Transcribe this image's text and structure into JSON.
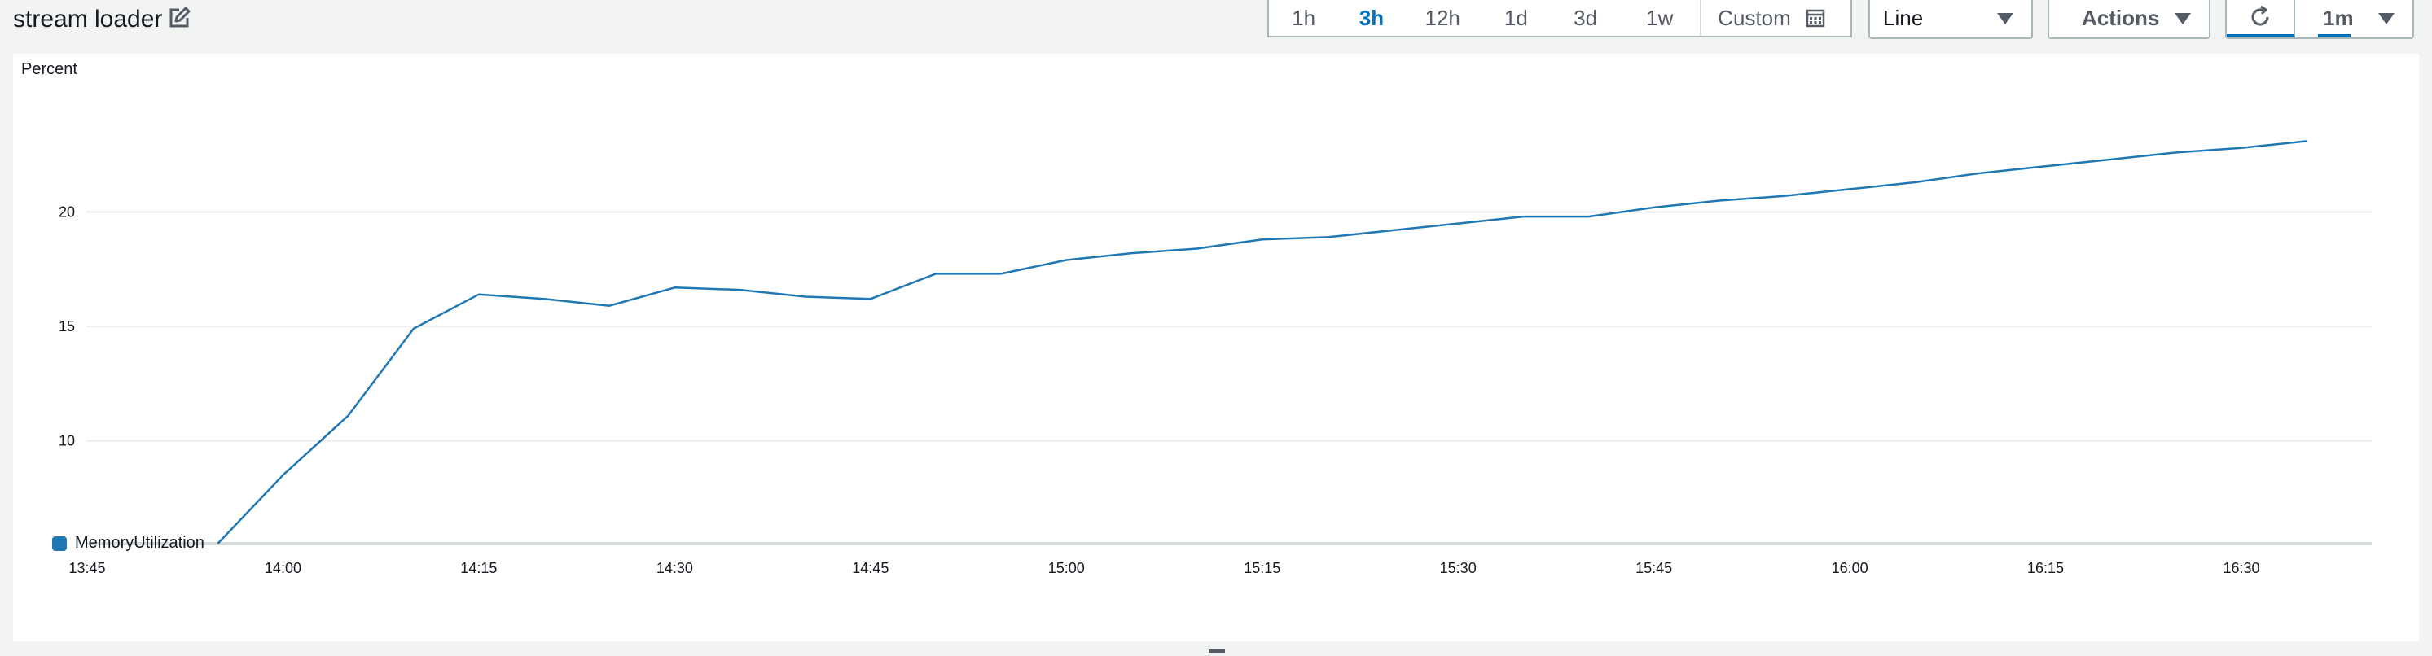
{
  "widget": {
    "title": "stream loader",
    "edit_icon": "edit-icon"
  },
  "time_range": {
    "options": [
      "1h",
      "3h",
      "12h",
      "1d",
      "3d",
      "1w"
    ],
    "active": "3h",
    "custom_label": "Custom",
    "calendar_icon": "calendar-icon"
  },
  "chart_type_dropdown": {
    "selected": "Line"
  },
  "actions_dropdown": {
    "label": "Actions"
  },
  "refresh": {
    "icon": "refresh-icon",
    "interval": "1m"
  },
  "colors": {
    "series": "#1f77b4",
    "active_tab": "#0073bb"
  },
  "chart_data": {
    "type": "line",
    "ylabel": "Percent",
    "xlabel": "",
    "ylim": [
      5.5,
      25
    ],
    "y_ticks": [
      10,
      15,
      20
    ],
    "x_tick_labels": [
      "13:45",
      "14:00",
      "14:15",
      "14:30",
      "14:45",
      "15:00",
      "15:15",
      "15:30",
      "15:45",
      "16:00",
      "16:15",
      "16:30"
    ],
    "x_start": "13:45",
    "x_end": "16:40",
    "grid": true,
    "legend_position": "bottom-left",
    "series": [
      {
        "name": "MemoryUtilization",
        "x": [
          "13:55",
          "14:00",
          "14:05",
          "14:10",
          "14:15",
          "14:20",
          "14:25",
          "14:30",
          "14:35",
          "14:40",
          "14:45",
          "14:50",
          "14:55",
          "15:00",
          "15:05",
          "15:10",
          "15:15",
          "15:20",
          "15:25",
          "15:30",
          "15:35",
          "15:40",
          "15:45",
          "15:50",
          "15:55",
          "16:00",
          "16:05",
          "16:10",
          "16:15",
          "16:20",
          "16:25",
          "16:30",
          "16:35"
        ],
        "values": [
          5.5,
          8.5,
          11.1,
          14.9,
          16.4,
          16.2,
          15.9,
          16.7,
          16.6,
          16.3,
          16.2,
          17.3,
          17.3,
          17.9,
          18.2,
          18.4,
          18.8,
          18.9,
          19.2,
          19.5,
          19.8,
          19.8,
          20.2,
          20.5,
          20.7,
          21.0,
          21.3,
          21.7,
          22.0,
          22.3,
          22.6,
          22.8,
          23.1
        ]
      }
    ]
  }
}
